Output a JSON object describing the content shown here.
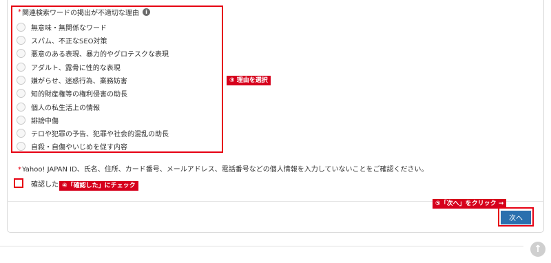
{
  "reason_section": {
    "required_mark": "*",
    "title": "関連検索ワードの掲出が不適切な理由",
    "info_icon": "i",
    "options": [
      {
        "label": "無意味・無関係なワード"
      },
      {
        "label": "スパム、不正なSEO対策"
      },
      {
        "label": "悪意のある表現、暴力的やグロテスクな表現"
      },
      {
        "label": "アダルト、露骨に性的な表現"
      },
      {
        "label": "嫌がらせ、迷惑行為、業務妨害"
      },
      {
        "label": "知的財産権等の権利侵害の助長"
      },
      {
        "label": "個人の私生活上の情報"
      },
      {
        "label": "誹謗中傷"
      },
      {
        "label": "テロや犯罪の予告、犯罪や社会的混乱の助長"
      },
      {
        "label": "自殺・自傷やいじめを促す内容"
      }
    ]
  },
  "notice": {
    "required_mark": "*",
    "text": "Yahoo! JAPAN ID、氏名、住所、カード番号、メールアドレス、電話番号などの個人情報を入力していないことをご確認ください。"
  },
  "confirm": {
    "label": "確認した",
    "checked": false
  },
  "next_button": {
    "label": "次へ"
  },
  "annotations": {
    "step3": "③ 理由を選択",
    "step4": "④「確認した」にチェック",
    "step5": "⑤「次へ」をクリック →"
  },
  "scroll_top_icon": "↑",
  "colors": {
    "annotation_red": "#e60012",
    "tag_bg": "#d6001c",
    "button_blue": "#2a6fae"
  }
}
